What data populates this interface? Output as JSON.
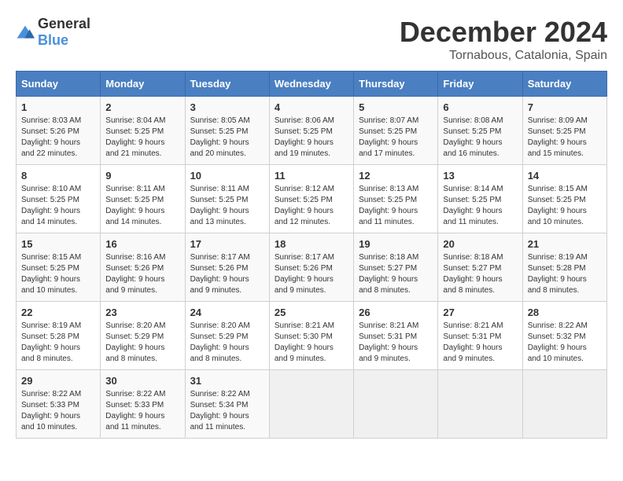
{
  "logo": {
    "general": "General",
    "blue": "Blue"
  },
  "title": "December 2024",
  "location": "Tornabous, Catalonia, Spain",
  "headers": [
    "Sunday",
    "Monday",
    "Tuesday",
    "Wednesday",
    "Thursday",
    "Friday",
    "Saturday"
  ],
  "weeks": [
    [
      {
        "day": "1",
        "sunrise": "8:03 AM",
        "sunset": "5:26 PM",
        "daylight": "9 hours and 22 minutes."
      },
      {
        "day": "2",
        "sunrise": "8:04 AM",
        "sunset": "5:25 PM",
        "daylight": "9 hours and 21 minutes."
      },
      {
        "day": "3",
        "sunrise": "8:05 AM",
        "sunset": "5:25 PM",
        "daylight": "9 hours and 20 minutes."
      },
      {
        "day": "4",
        "sunrise": "8:06 AM",
        "sunset": "5:25 PM",
        "daylight": "9 hours and 19 minutes."
      },
      {
        "day": "5",
        "sunrise": "8:07 AM",
        "sunset": "5:25 PM",
        "daylight": "9 hours and 17 minutes."
      },
      {
        "day": "6",
        "sunrise": "8:08 AM",
        "sunset": "5:25 PM",
        "daylight": "9 hours and 16 minutes."
      },
      {
        "day": "7",
        "sunrise": "8:09 AM",
        "sunset": "5:25 PM",
        "daylight": "9 hours and 15 minutes."
      }
    ],
    [
      {
        "day": "8",
        "sunrise": "8:10 AM",
        "sunset": "5:25 PM",
        "daylight": "9 hours and 14 minutes."
      },
      {
        "day": "9",
        "sunrise": "8:11 AM",
        "sunset": "5:25 PM",
        "daylight": "9 hours and 14 minutes."
      },
      {
        "day": "10",
        "sunrise": "8:11 AM",
        "sunset": "5:25 PM",
        "daylight": "9 hours and 13 minutes."
      },
      {
        "day": "11",
        "sunrise": "8:12 AM",
        "sunset": "5:25 PM",
        "daylight": "9 hours and 12 minutes."
      },
      {
        "day": "12",
        "sunrise": "8:13 AM",
        "sunset": "5:25 PM",
        "daylight": "9 hours and 11 minutes."
      },
      {
        "day": "13",
        "sunrise": "8:14 AM",
        "sunset": "5:25 PM",
        "daylight": "9 hours and 11 minutes."
      },
      {
        "day": "14",
        "sunrise": "8:15 AM",
        "sunset": "5:25 PM",
        "daylight": "9 hours and 10 minutes."
      }
    ],
    [
      {
        "day": "15",
        "sunrise": "8:15 AM",
        "sunset": "5:25 PM",
        "daylight": "9 hours and 10 minutes."
      },
      {
        "day": "16",
        "sunrise": "8:16 AM",
        "sunset": "5:26 PM",
        "daylight": "9 hours and 9 minutes."
      },
      {
        "day": "17",
        "sunrise": "8:17 AM",
        "sunset": "5:26 PM",
        "daylight": "9 hours and 9 minutes."
      },
      {
        "day": "18",
        "sunrise": "8:17 AM",
        "sunset": "5:26 PM",
        "daylight": "9 hours and 9 minutes."
      },
      {
        "day": "19",
        "sunrise": "8:18 AM",
        "sunset": "5:27 PM",
        "daylight": "9 hours and 8 minutes."
      },
      {
        "day": "20",
        "sunrise": "8:18 AM",
        "sunset": "5:27 PM",
        "daylight": "9 hours and 8 minutes."
      },
      {
        "day": "21",
        "sunrise": "8:19 AM",
        "sunset": "5:28 PM",
        "daylight": "9 hours and 8 minutes."
      }
    ],
    [
      {
        "day": "22",
        "sunrise": "8:19 AM",
        "sunset": "5:28 PM",
        "daylight": "9 hours and 8 minutes."
      },
      {
        "day": "23",
        "sunrise": "8:20 AM",
        "sunset": "5:29 PM",
        "daylight": "9 hours and 8 minutes."
      },
      {
        "day": "24",
        "sunrise": "8:20 AM",
        "sunset": "5:29 PM",
        "daylight": "9 hours and 8 minutes."
      },
      {
        "day": "25",
        "sunrise": "8:21 AM",
        "sunset": "5:30 PM",
        "daylight": "9 hours and 9 minutes."
      },
      {
        "day": "26",
        "sunrise": "8:21 AM",
        "sunset": "5:31 PM",
        "daylight": "9 hours and 9 minutes."
      },
      {
        "day": "27",
        "sunrise": "8:21 AM",
        "sunset": "5:31 PM",
        "daylight": "9 hours and 9 minutes."
      },
      {
        "day": "28",
        "sunrise": "8:22 AM",
        "sunset": "5:32 PM",
        "daylight": "9 hours and 10 minutes."
      }
    ],
    [
      {
        "day": "29",
        "sunrise": "8:22 AM",
        "sunset": "5:33 PM",
        "daylight": "9 hours and 10 minutes."
      },
      {
        "day": "30",
        "sunrise": "8:22 AM",
        "sunset": "5:33 PM",
        "daylight": "9 hours and 11 minutes."
      },
      {
        "day": "31",
        "sunrise": "8:22 AM",
        "sunset": "5:34 PM",
        "daylight": "9 hours and 11 minutes."
      },
      null,
      null,
      null,
      null
    ]
  ],
  "labels": {
    "sunrise": "Sunrise:",
    "sunset": "Sunset:",
    "daylight": "Daylight:"
  }
}
